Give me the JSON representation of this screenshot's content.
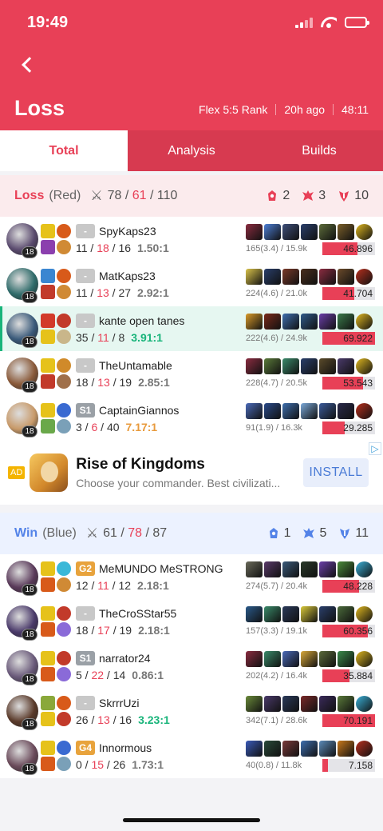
{
  "status_bar": {
    "time": "19:49"
  },
  "header": {
    "title": "Loss",
    "queue": "Flex 5:5 Rank",
    "ago": "20h ago",
    "duration": "48:11"
  },
  "tabs": [
    {
      "label": "Total",
      "active": true
    },
    {
      "label": "Analysis",
      "active": false
    },
    {
      "label": "Builds",
      "active": false
    }
  ],
  "loss_team": {
    "result": "Loss",
    "side": "(Red)",
    "kills": "78",
    "deaths": "61",
    "assists": "110",
    "towers": "2",
    "dragons": "3",
    "barons": "10",
    "accent": "#e84057",
    "players": [
      {
        "champ_color": "#5a4a6e",
        "level": "18",
        "tier": "-",
        "name": "SpyKaps23",
        "k": "11",
        "d": "18",
        "a": "16",
        "ratio": "1.50:1",
        "ratio_style": "gray",
        "cs": "165(3.4) / 15.9k",
        "damage": "46.896",
        "dmg_frac": 0.67,
        "spell_colors": [
          "#e6c21a",
          "#d85a1a",
          "#8b3fae",
          "#d08a35"
        ],
        "item_colors": [
          "#8a2c40",
          "#4d7fd6",
          "#3e4f7a",
          "#2a3f6b",
          "#5c6b3a",
          "#7b5f2a",
          "#e0b820"
        ]
      },
      {
        "champ_color": "#2f6b6a",
        "level": "18",
        "tier": "-",
        "name": "MatKaps23",
        "k": "11",
        "d": "13",
        "a": "27",
        "ratio": "2.92:1",
        "ratio_style": "gray",
        "cs": "224(4.6) / 21.0k",
        "damage": "41.704",
        "dmg_frac": 0.6,
        "spell_colors": [
          "#3a86d1",
          "#d85a1a",
          "#c23a2a",
          "#d08a35"
        ],
        "item_colors": [
          "#d9c34a",
          "#2a3f6b",
          "#7a3a2a",
          "#4a2f1e",
          "#8a2c40",
          "#6b4a2a",
          "#b8301e"
        ]
      },
      {
        "champ_color": "#3a5a7a",
        "level": "18",
        "tier": "-",
        "name": "kante open tanes",
        "k": "35",
        "d": "11",
        "a": "8",
        "ratio": "3.91:1",
        "ratio_style": "green",
        "cs": "222(4.6) / 24.9k",
        "damage": "69.922",
        "dmg_frac": 1.0,
        "spell_colors": [
          "#d23a2a",
          "#c23a2a",
          "#e6c21a",
          "#c9b68a"
        ],
        "item_colors": [
          "#d89a2a",
          "#7a2a1a",
          "#3e6fae",
          "#2f5a8a",
          "#6a3ea8",
          "#3a7a4a",
          "#e0b820"
        ]
      },
      {
        "champ_color": "#8a5a3a",
        "level": "18",
        "tier": "-",
        "name": "TheUntamable",
        "k": "18",
        "d": "13",
        "a": "19",
        "ratio": "2.85:1",
        "ratio_style": "gray",
        "cs": "228(4.7) / 20.5k",
        "damage": "53.543",
        "dmg_frac": 0.77,
        "spell_colors": [
          "#e6c21a",
          "#d08a2a",
          "#c23a2a",
          "#a0704a"
        ],
        "item_colors": [
          "#8a2c40",
          "#5a7a3a",
          "#3a8a6a",
          "#2a3f6b",
          "#5a4a2a",
          "#4a3a6a",
          "#e0b820"
        ]
      },
      {
        "champ_color": "#c89a6a",
        "level": "18",
        "tier": "S1",
        "name": "CaptainGiannos",
        "k": "3",
        "d": "6",
        "a": "40",
        "ratio": "7.17:1",
        "ratio_style": "orange",
        "cs": "91(1.9) / 16.3k",
        "damage": "29.285",
        "dmg_frac": 0.42,
        "spell_colors": [
          "#e6c21a",
          "#3a6ad1",
          "#6aa84a",
          "#7aa0b8"
        ],
        "item_colors": [
          "#4a6ab8",
          "#2a4a8a",
          "#3e6fae",
          "#7aa8d8",
          "#3a5a9a",
          "#2a2a4a",
          "#b8301e"
        ]
      }
    ]
  },
  "ad": {
    "badge": "AD",
    "title": "Rise of Kingdoms",
    "subtitle": "Choose your commander. Best civilizati...",
    "button": "INSTALL",
    "choice": "▷"
  },
  "win_team": {
    "result": "Win",
    "side": "(Blue)",
    "kills": "61",
    "deaths": "78",
    "assists": "87",
    "towers": "1",
    "dragons": "5",
    "barons": "11",
    "accent": "#5383e8",
    "players": [
      {
        "champ_color": "#5a3a5a",
        "level": "18",
        "tier": "G2",
        "name": "MeMUNDO MeSTRONG",
        "k": "12",
        "d": "11",
        "a": "12",
        "ratio": "2.18:1",
        "ratio_style": "gray",
        "cs": "274(5.7) / 20.4k",
        "damage": "48.228",
        "dmg_frac": 0.69,
        "spell_colors": [
          "#e6c21a",
          "#3ab8d8",
          "#d85a1a",
          "#d08a35"
        ],
        "item_colors": [
          "#6a6a5a",
          "#5a3a6a",
          "#3a5a7a",
          "#2a3a2a",
          "#6a3ea8",
          "#4a8a3a",
          "#3ab0d8"
        ]
      },
      {
        "champ_color": "#4a3a6a",
        "level": "18",
        "tier": "-",
        "name": "TheCroSStar55",
        "k": "18",
        "d": "17",
        "a": "19",
        "ratio": "2.18:1",
        "ratio_style": "gray",
        "cs": "157(3.3) / 19.1k",
        "damage": "60.356",
        "dmg_frac": 0.86,
        "spell_colors": [
          "#e6c21a",
          "#c23a2a",
          "#d85a1a",
          "#8a6ad8"
        ],
        "item_colors": [
          "#2a5a8a",
          "#3a8a6a",
          "#2a3a5a",
          "#d8c83a",
          "#2a3f6b",
          "#4a6a3a",
          "#e0b820"
        ]
      },
      {
        "champ_color": "#6a5a7a",
        "level": "18",
        "tier": "S1",
        "name": "narrator24",
        "k": "5",
        "d": "22",
        "a": "14",
        "ratio": "0.86:1",
        "ratio_style": "gray",
        "cs": "202(4.2) / 16.4k",
        "damage": "35.884",
        "dmg_frac": 0.51,
        "spell_colors": [
          "#e6c21a",
          "#c23a2a",
          "#d85a1a",
          "#8a6ad8"
        ],
        "item_colors": [
          "#8a2c40",
          "#3a8a6a",
          "#4a6ab8",
          "#d8a83a",
          "#5a6a3a",
          "#3a8a4a",
          "#e0b820"
        ]
      },
      {
        "champ_color": "#5a3a2a",
        "level": "18",
        "tier": "-",
        "name": "SkrrrUzi",
        "k": "26",
        "d": "13",
        "a": "16",
        "ratio": "3.23:1",
        "ratio_style": "green",
        "cs": "342(7.1) / 28.6k",
        "damage": "70.191",
        "dmg_frac": 1.0,
        "spell_colors": [
          "#8aa83a",
          "#d85a1a",
          "#e6c21a",
          "#c23a2a"
        ],
        "item_colors": [
          "#6a8a3a",
          "#4a3a6a",
          "#2a3a5a",
          "#7a2a2a",
          "#3a2a5a",
          "#5a7a3a",
          "#3ab0d8"
        ]
      },
      {
        "champ_color": "#6a4a5a",
        "level": "18",
        "tier": "G4",
        "name": "Innormous",
        "k": "0",
        "d": "15",
        "a": "26",
        "ratio": "1.73:1",
        "ratio_style": "gray",
        "cs": "40(0.8) / 11.8k",
        "damage": "7.158",
        "dmg_frac": 0.1,
        "spell_colors": [
          "#e6c21a",
          "#3a6ad1",
          "#d85a1a",
          "#7aa0b8"
        ],
        "item_colors": [
          "#3a5ab8",
          "#2a4a3a",
          "#7a3a3a",
          "#3e6fae",
          "#5a8ab8",
          "#c8781a",
          "#b8301e"
        ]
      }
    ]
  }
}
